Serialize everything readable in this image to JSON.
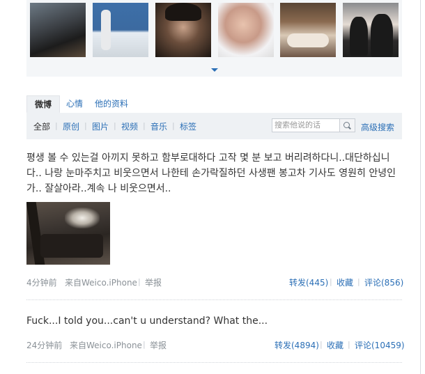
{
  "photos": [
    {
      "icon": "photo-car-night"
    },
    {
      "icon": "photo-tennis"
    },
    {
      "icon": "photo-helmet"
    },
    {
      "icon": "photo-smile"
    },
    {
      "icon": "photo-lying"
    },
    {
      "icon": "photo-group"
    }
  ],
  "tabs": [
    "微博",
    "心情",
    "他的资料"
  ],
  "filters": [
    "全部",
    "原创",
    "图片",
    "视频",
    "音乐",
    "标签"
  ],
  "search": {
    "placeholder": "搜索他说的话",
    "advanced_label": "高级搜索"
  },
  "posts": [
    {
      "text": "평생 볼 수 있는걸 아끼지 못하고 함부로대하다 고작 몇 분 보고 버리려하다니..대단하십니다.. 나랑 눈마주치고 비웃으면서 나한테 손가락질하던 사생팬 봉고차 기사도 영원히 안녕인가.. 잘살아라..계속 나 비웃으면서..",
      "time": "4分钟前",
      "source": "来自Weico.iPhone",
      "report": "举报",
      "repost": "转发(445)",
      "favorite": "收藏",
      "comment": "评论(856)"
    },
    {
      "text": "Fuck...I told you...can't u understand? What the...",
      "time": "24分钟前",
      "source": "来自Weico.iPhone",
      "report": "举报",
      "repost": "转发(4894)",
      "favorite": "收藏",
      "comment": "评论(10459)"
    }
  ],
  "colors": {
    "link": "#2b6fb6",
    "meta": "#8a9197",
    "tab_bg": "#eef1f4"
  }
}
